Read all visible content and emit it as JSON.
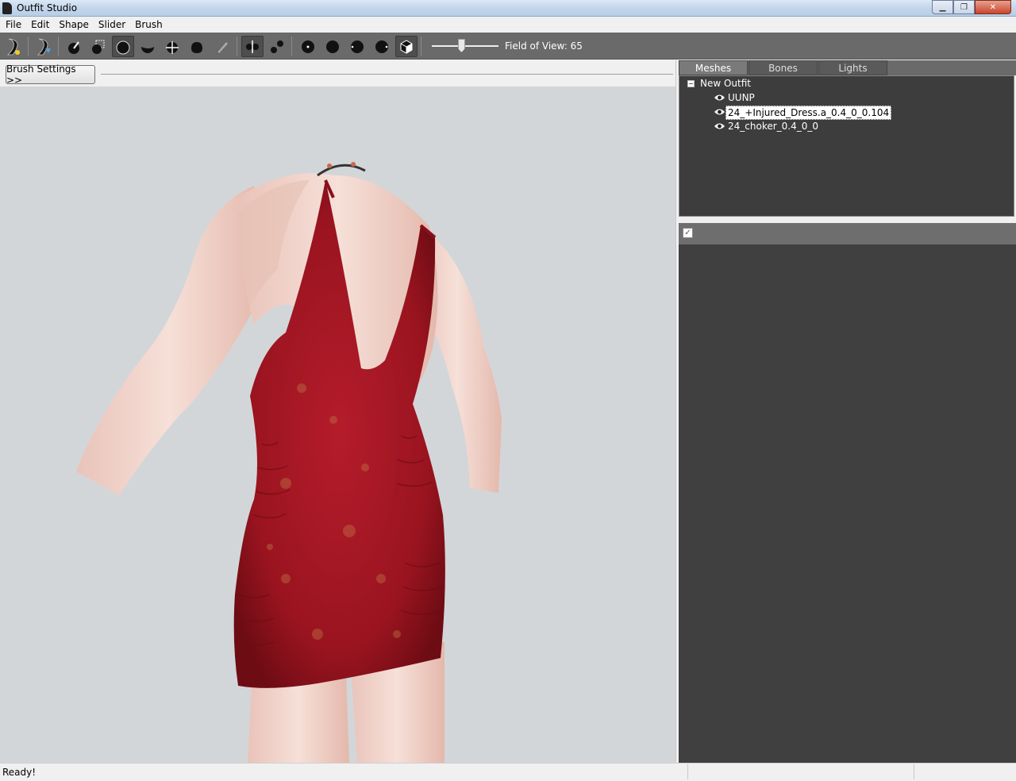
{
  "window": {
    "title": "Outfit Studio"
  },
  "menu": {
    "items": [
      "File",
      "Edit",
      "Shape",
      "Slider",
      "Brush"
    ]
  },
  "toolbar": {
    "tools": [
      "new-project-icon",
      "load-reference-icon",
      "select-brush-icon",
      "mask-brush-icon",
      "inflate-brush-icon",
      "deflate-brush-icon",
      "move-brush-icon",
      "smooth-brush-icon",
      "weight-brush-icon",
      "mirror-icon",
      "connected-icon",
      "vertex-small-icon",
      "vertex-medium-icon",
      "vertex-large-icon",
      "vertex-xlarge-icon",
      "wireframe-icon"
    ],
    "field_of_view_label": "Field of View: 65",
    "field_of_view_fraction": 0.44
  },
  "brush_settings": {
    "label": "Brush Settings >>"
  },
  "tabs": [
    {
      "label": "Meshes",
      "selected": true
    },
    {
      "label": "Bones",
      "selected": false
    },
    {
      "label": "Lights",
      "selected": false
    }
  ],
  "tree": {
    "root": "New Outfit",
    "root_toggle": "−",
    "items": [
      "UUNP",
      "24_+Injured_Dress.a_0.4_0_0.104",
      "24_choker_0.4_0_0"
    ],
    "selected_index": 1
  },
  "sliders": {
    "check": "✓"
  },
  "status": {
    "text": "Ready!"
  },
  "colors": {
    "toolbar": "#6a6a6a",
    "panel": "#3d3d3d",
    "viewport": "#d3d6d8",
    "dress": "#a0161f",
    "skin": "#f0d6cc"
  }
}
